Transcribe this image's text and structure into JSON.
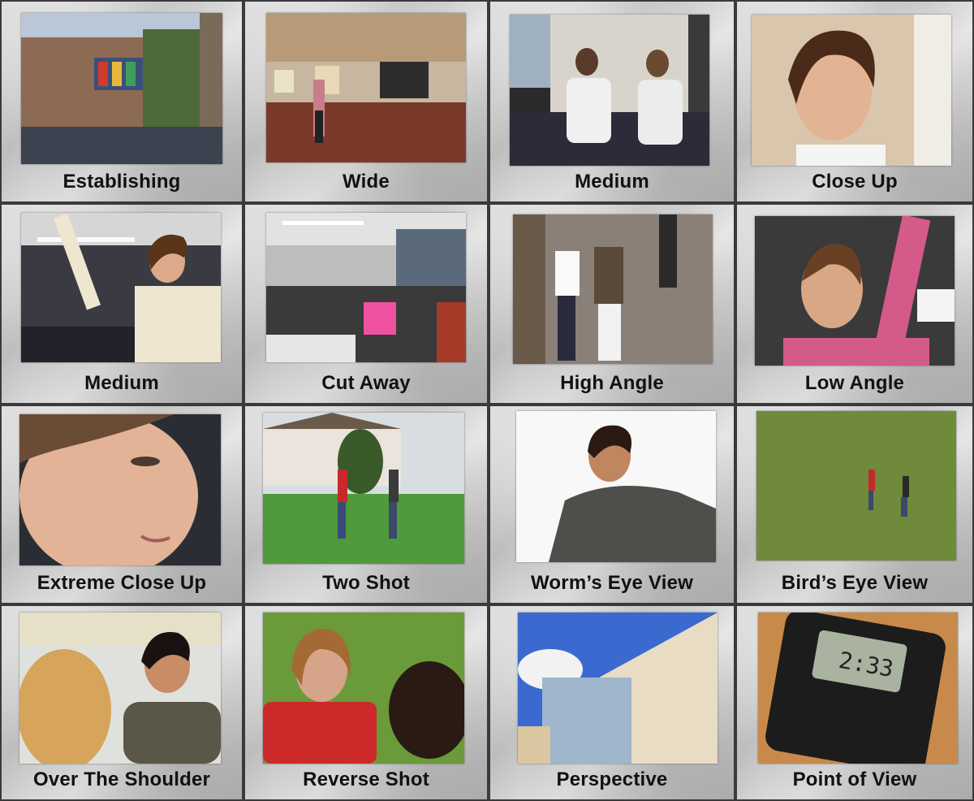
{
  "shots": [
    {
      "label": "Establishing"
    },
    {
      "label": "Wide"
    },
    {
      "label": "Medium"
    },
    {
      "label": "Close Up"
    },
    {
      "label": "Medium"
    },
    {
      "label": "Cut Away"
    },
    {
      "label": "High Angle"
    },
    {
      "label": "Low Angle"
    },
    {
      "label": "Extreme Close Up"
    },
    {
      "label": "Two Shot"
    },
    {
      "label": "Worm’s Eye View"
    },
    {
      "label": "Bird’s Eye View"
    },
    {
      "label": "Over The Shoulder"
    },
    {
      "label": "Reverse Shot"
    },
    {
      "label": "Perspective"
    },
    {
      "label": "Point of View"
    }
  ]
}
